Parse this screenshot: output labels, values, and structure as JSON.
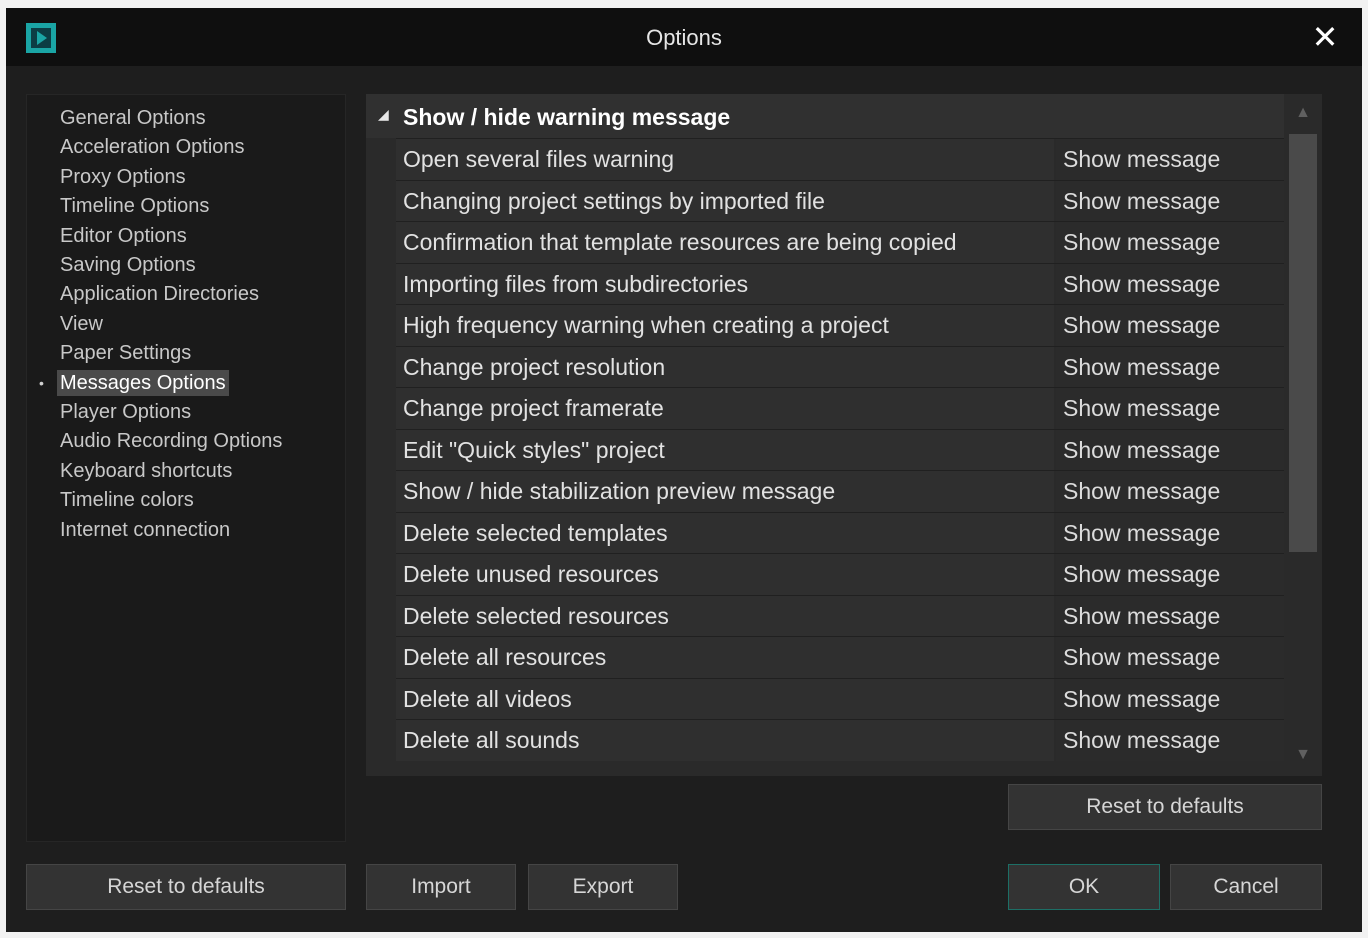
{
  "window": {
    "title": "Options",
    "close_icon": "close-icon",
    "app_icon": "app-logo-icon"
  },
  "sidebar": {
    "items": [
      {
        "label": "General Options"
      },
      {
        "label": "Acceleration Options"
      },
      {
        "label": "Proxy Options"
      },
      {
        "label": "Timeline Options"
      },
      {
        "label": "Editor Options"
      },
      {
        "label": "Saving Options"
      },
      {
        "label": "Application Directories"
      },
      {
        "label": "View"
      },
      {
        "label": "Paper Settings"
      },
      {
        "label": "Messages Options",
        "selected": true
      },
      {
        "label": "Player Options"
      },
      {
        "label": "Audio Recording Options"
      },
      {
        "label": "Keyboard shortcuts"
      },
      {
        "label": "Timeline colors"
      },
      {
        "label": "Internet connection"
      }
    ]
  },
  "group": {
    "title": "Show / hide warning message",
    "expanded": true
  },
  "rows": [
    {
      "label": "Open several files warning",
      "value": "Show message"
    },
    {
      "label": "Changing project settings by imported file",
      "value": "Show message"
    },
    {
      "label": "Confirmation that template resources are being copied",
      "value": "Show message"
    },
    {
      "label": "Importing files from subdirectories",
      "value": "Show message"
    },
    {
      "label": "High frequency warning when creating a project",
      "value": "Show message"
    },
    {
      "label": "Change project resolution",
      "value": "Show message"
    },
    {
      "label": "Change project framerate",
      "value": "Show message"
    },
    {
      "label": "Edit \"Quick styles\" project",
      "value": "Show message"
    },
    {
      "label": "Show / hide stabilization preview message",
      "value": "Show message"
    },
    {
      "label": "Delete selected templates",
      "value": "Show message"
    },
    {
      "label": "Delete unused resources",
      "value": "Show message"
    },
    {
      "label": "Delete selected resources",
      "value": "Show message"
    },
    {
      "label": "Delete all resources",
      "value": "Show message"
    },
    {
      "label": "Delete all videos",
      "value": "Show message"
    },
    {
      "label": "Delete all sounds",
      "value": "Show message"
    }
  ],
  "buttons": {
    "panel_reset": "Reset to defaults",
    "global_reset": "Reset to defaults",
    "import": "Import",
    "export": "Export",
    "ok": "OK",
    "cancel": "Cancel"
  },
  "colors": {
    "accent": "#1aa5a5",
    "background": "#1e1e1e",
    "selection": "#4a4a4a"
  }
}
